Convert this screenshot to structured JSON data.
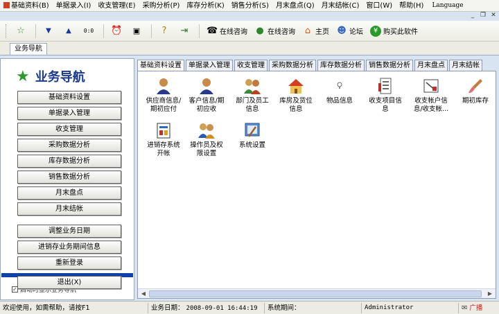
{
  "menu": {
    "items": [
      "基础资料(B)",
      "单据录入(I)",
      "收支管理(E)",
      "采购分析(P)",
      "库存分析(K)",
      "销售分析(S)",
      "月末盘点(Q)",
      "月末结帐(C)",
      "窗口(W)",
      "帮助(H)"
    ],
    "language": "Language"
  },
  "toolbar": {
    "consult1": "在线咨询",
    "consult2": "在线咨询",
    "home": "主页",
    "forum": "论坛",
    "buy": "购买此软件"
  },
  "nav_tab": "业务导航",
  "left_panel": {
    "title": "业务导航",
    "buttons": [
      "基础资料设置",
      "单据录入管理",
      "收支管理",
      "采购数据分析",
      "库存数据分析",
      "销售数据分析",
      "月末盘点",
      "月末结帐"
    ],
    "buttons2": [
      "调整业务日期",
      "进销存业务期间信息",
      "重新登录",
      "退出(X)"
    ],
    "checkbox_label": "启动时显示业务导航"
  },
  "tabs": [
    "基础资料设置",
    "单据录入管理",
    "收支管理",
    "采购数据分析",
    "库存数据分析",
    "销售数据分析",
    "月末盘点",
    "月末结帐"
  ],
  "modules": {
    "m0": [
      "供应商信息/",
      "期初应付"
    ],
    "m1": [
      "客户信息/期",
      "初应收"
    ],
    "m2": [
      "部门及员工",
      "信息"
    ],
    "m3": [
      "库房及货位",
      "信息"
    ],
    "m4": [
      "物品信息",
      ""
    ],
    "m5": [
      "收支项目信",
      "息"
    ],
    "m6": [
      "收支帐户信",
      "息/收支帐..."
    ],
    "m7": [
      "期初库存",
      ""
    ],
    "m8": [
      "进销存系统",
      "开帐"
    ],
    "m9": [
      "操作员及权",
      "限设置"
    ],
    "m10": [
      "系统设置",
      ""
    ]
  },
  "status": {
    "welcome": "欢迎使用，如需帮助，请按F1",
    "biz_date_label": "业务日期：",
    "biz_date": "2008-09-01 16:44:19",
    "sys_period_label": "系统期间：",
    "user": "Administrator",
    "broadcast": "广播"
  },
  "colors": {
    "title_blue": "#1a3a8a",
    "accent_bar": "#1040a8",
    "broadcast_red": "#cc2020"
  }
}
